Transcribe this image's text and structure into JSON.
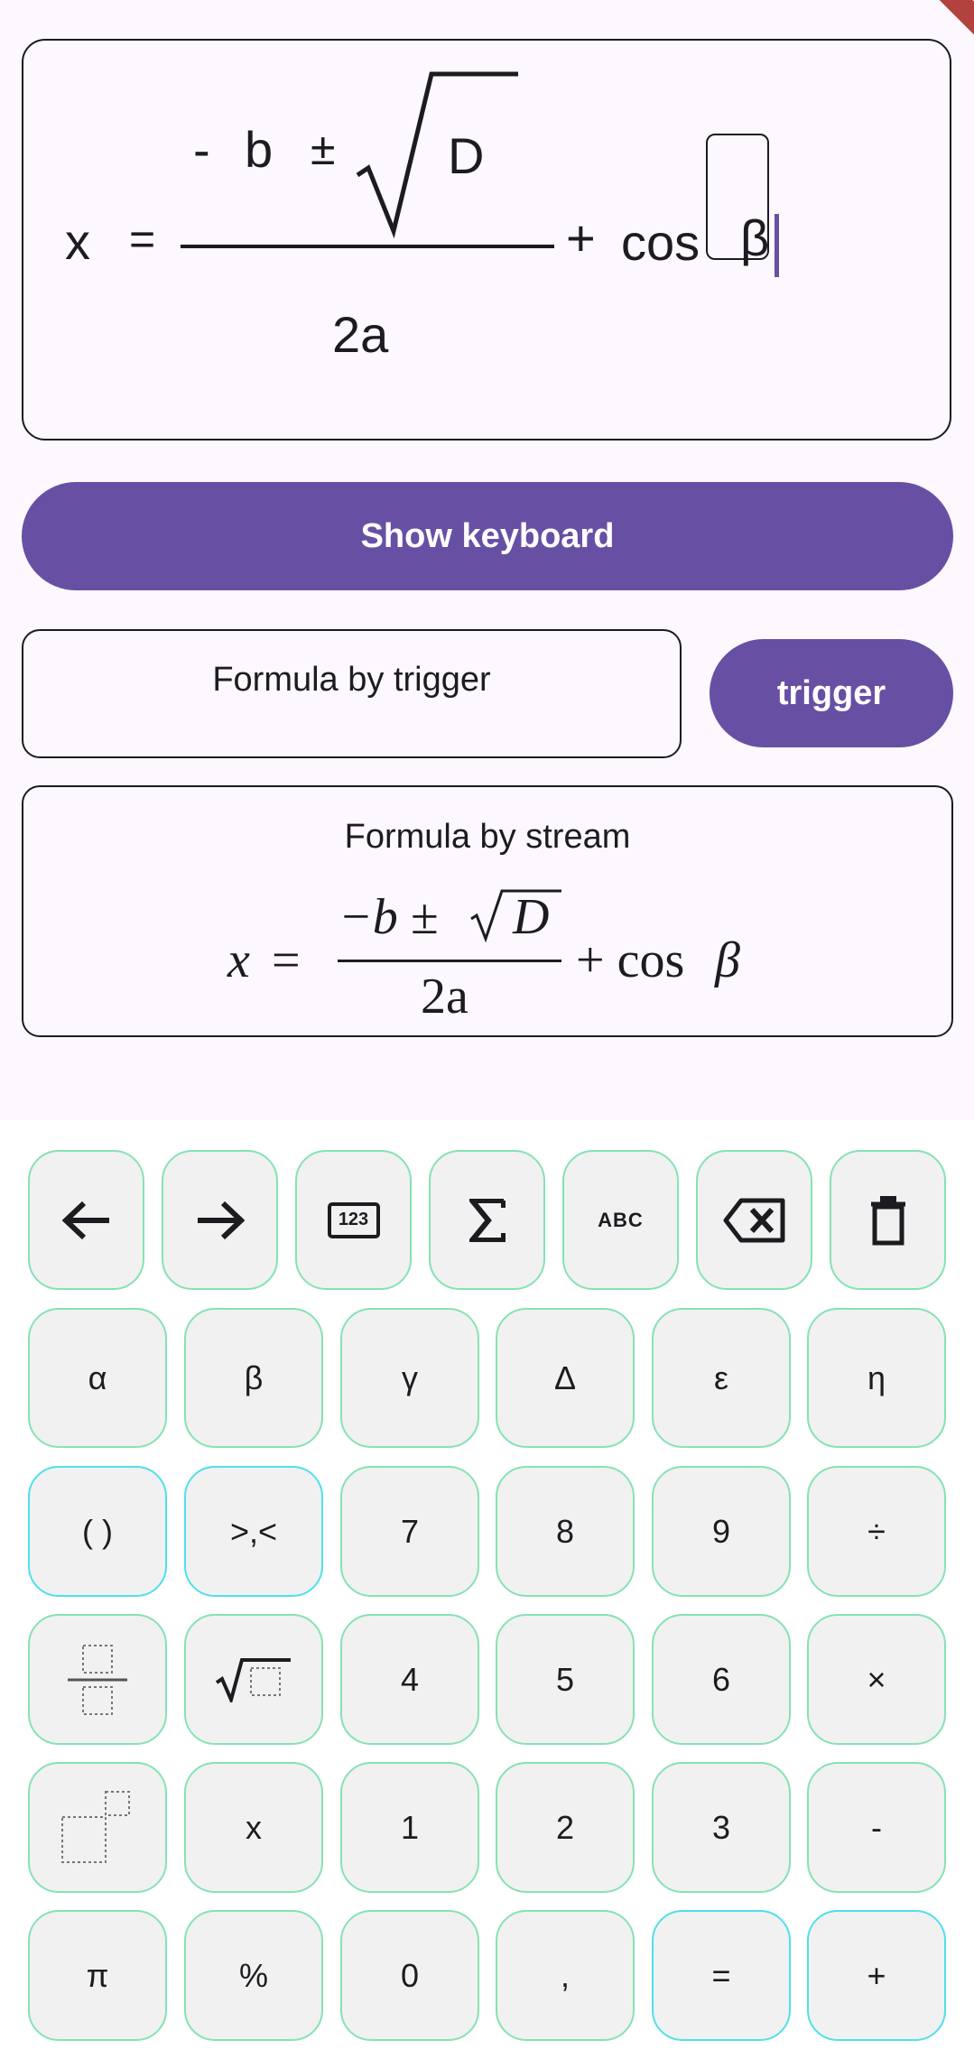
{
  "editor": {
    "x": "x",
    "eq": "=",
    "minus": "-",
    "b": "b",
    "pm": "±",
    "D": "D",
    "denominator": "2a",
    "plus": "+",
    "cos": "cos",
    "beta": "β"
  },
  "buttons": {
    "show_keyboard": "Show keyboard",
    "trigger": "trigger"
  },
  "trigger_box": {
    "label": "Formula by trigger"
  },
  "stream_box": {
    "label": "Formula by stream",
    "x": "x",
    "eq": "=",
    "num": "−b ±",
    "D": "D",
    "den": "2a",
    "plus_cos": "+ cos",
    "beta": "β"
  },
  "keyboard": {
    "row1": [
      "back-arrow-icon",
      "forward-arrow-icon",
      "numpad-123-icon",
      "sigma-icon",
      "abc-icon",
      "backspace-icon",
      "trash-icon"
    ],
    "row1_labels": {
      "numpad": "123",
      "abc": "ABC"
    },
    "row2": [
      "α",
      "β",
      "γ",
      "Δ",
      "ε",
      "η"
    ],
    "row3": [
      "( )",
      ">,<",
      "7",
      "8",
      "9",
      "÷"
    ],
    "row4": [
      "fraction-icon",
      "sqrt-icon",
      "4",
      "5",
      "6",
      "×"
    ],
    "row5": [
      "power-icon",
      "x",
      "1",
      "2",
      "3",
      "-"
    ],
    "row6": [
      "π",
      "%",
      "0",
      ",",
      "=",
      "+"
    ]
  },
  "colors": {
    "primary": "#6750a4",
    "key_border": "#86e2b4",
    "key_border_accent": "#4fe0ea",
    "key_fill": "#f1f1f1",
    "background": "#fdf7fe"
  }
}
